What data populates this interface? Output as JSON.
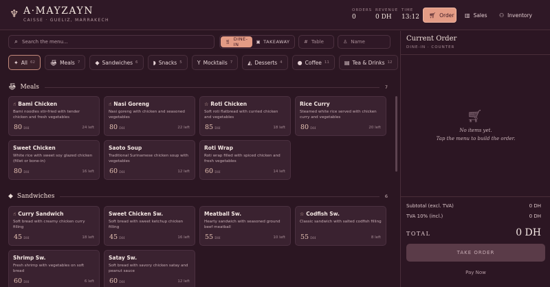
{
  "brand": {
    "name": "A·MAYZAYN",
    "subtitle": "CAISSE · GUELIZ, MARRAKECH",
    "logo_icon": "tagine-icon"
  },
  "stats": [
    {
      "label": "ORDERS",
      "value": "0"
    },
    {
      "label": "REVENUE",
      "value": "0 DH"
    },
    {
      "label": "TIME",
      "value": "13:12"
    }
  ],
  "nav": [
    {
      "label": "Order",
      "icon": "cart-icon",
      "active": true
    },
    {
      "label": "Sales",
      "icon": "chart-icon",
      "active": false
    },
    {
      "label": "Inventory",
      "icon": "people-icon",
      "active": false
    }
  ],
  "search": {
    "placeholder": "Search the menu..."
  },
  "mode": {
    "dine_in": "DINE-IN",
    "takeaway": "TAKEAWAY"
  },
  "fields": {
    "table": "Table",
    "name": "Name"
  },
  "categories": [
    {
      "label": "All",
      "count": "62"
    },
    {
      "label": "Meals",
      "count": "7"
    },
    {
      "label": "Sandwiches",
      "count": "6"
    },
    {
      "label": "Snacks",
      "count": "5"
    },
    {
      "label": "Mocktails",
      "count": "7"
    },
    {
      "label": "Desserts",
      "count": "4"
    },
    {
      "label": "Coffee",
      "count": "11"
    },
    {
      "label": "Tea & Drinks",
      "count": "12"
    }
  ],
  "sections": [
    {
      "title": "Meals",
      "count": "7",
      "items": [
        {
          "name": "Bami Chicken",
          "desc": "Bami noodles stir-fried with tender chicken and fresh vegetables",
          "price": "80",
          "left": "24 left",
          "badge": "hand"
        },
        {
          "name": "Nasi Goreng",
          "desc": "Nasi goreng with chicken and seasoned vegetables",
          "price": "80",
          "left": "22 left",
          "badge": "hand"
        },
        {
          "name": "Roti Chicken",
          "desc": "Soft roti flatbread with curried chicken and vegetables",
          "price": "85",
          "left": "18 left",
          "badge": "star"
        },
        {
          "name": "Rice Curry",
          "desc": "Steamed white rice served with chicken curry and vegetables",
          "price": "80",
          "left": "20 left",
          "badge": ""
        },
        {
          "name": "Sweet Chicken",
          "desc": "White rice with sweet soy glazed chicken (fillet or bone-in)",
          "price": "80",
          "left": "16 left",
          "badge": ""
        },
        {
          "name": "Saoto Soup",
          "desc": "Traditional Surinamese chicken soup with vegetables",
          "price": "60",
          "left": "12 left",
          "badge": ""
        },
        {
          "name": "Roti Wrap",
          "desc": "Roti wrap filled with spiced chicken and fresh vegetables",
          "price": "60",
          "left": "14 left",
          "badge": ""
        }
      ]
    },
    {
      "title": "Sandwiches",
      "count": "6",
      "items": [
        {
          "name": "Curry Sandwich",
          "desc": "Soft bread with creamy chicken curry filling",
          "price": "45",
          "left": "18 left",
          "badge": "hand"
        },
        {
          "name": "Sweet Chicken Sw.",
          "desc": "Soft bread with sweet ketchup chicken filling",
          "price": "45",
          "left": "16 left",
          "badge": ""
        },
        {
          "name": "Meatball Sw.",
          "desc": "Hearty sandwich with seasoned ground beef meatball",
          "price": "55",
          "left": "10 left",
          "badge": ""
        },
        {
          "name": "Codfish Sw.",
          "desc": "Classic sandwich with salted codfish filling",
          "price": "55",
          "left": "8 left",
          "badge": "star"
        },
        {
          "name": "Shrimp Sw.",
          "desc": "Fresh shrimp with vegetables on soft bread",
          "price": "60",
          "left": "6 left",
          "badge": ""
        },
        {
          "name": "Satay Sw.",
          "desc": "Soft bread with savory chicken satay and peanut sauce",
          "price": "60",
          "left": "12 left",
          "badge": ""
        }
      ]
    }
  ],
  "currency": "DH",
  "order": {
    "title": "Current Order",
    "subtitle": "DINE-IN · COUNTER",
    "empty_line1": "No items yet.",
    "empty_line2": "Tap the menu to build the order.",
    "subtotal_label": "Subtotal (excl. TVA)",
    "subtotal_value": "0 DH",
    "tva_label": "TVA 10% (incl.)",
    "tva_value": "0 DH",
    "total_label": "TOTAL",
    "total_value": "0 DH",
    "take_order": "TAKE ORDER",
    "pay_now": "Pay Now"
  },
  "colors": {
    "accent": "#e39b85",
    "background": "#2b1622",
    "card": "#3a2230"
  }
}
